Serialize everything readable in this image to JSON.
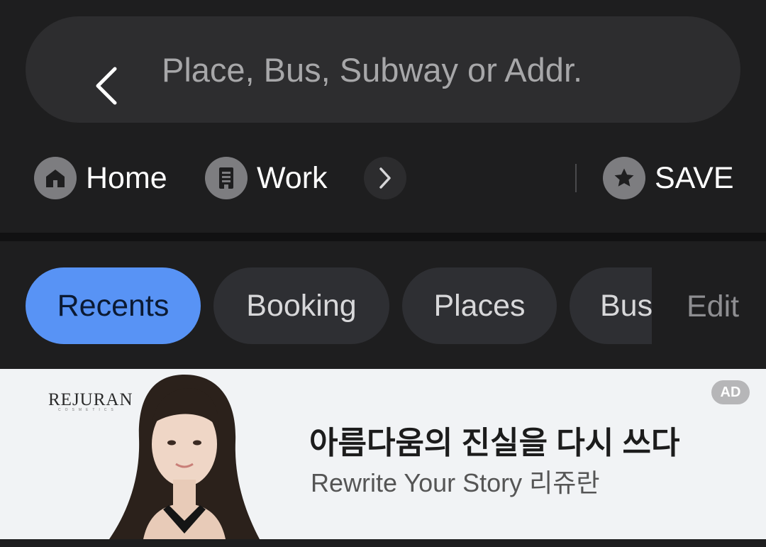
{
  "search": {
    "placeholder": "Place, Bus, Subway or Addr.",
    "back_icon": "chevron-left-icon"
  },
  "shortcuts": {
    "home_label": "Home",
    "work_label": "Work",
    "save_label": "SAVE"
  },
  "tabs": [
    {
      "label": "Recents",
      "active": true
    },
    {
      "label": "Booking",
      "active": false
    },
    {
      "label": "Places",
      "active": false
    },
    {
      "label": "Bus",
      "active": false
    }
  ],
  "edit_label": "Edit",
  "ad": {
    "brand": "REJURAN",
    "brand_sub": "COSMETICS",
    "headline": "아름다움의 진실을 다시 쓰다",
    "subline": "Rewrite Your Story 리쥬란",
    "badge": "AD"
  },
  "colors": {
    "accent": "#5893f5",
    "background": "#1e1e1f",
    "chip": "#2e2f33"
  }
}
